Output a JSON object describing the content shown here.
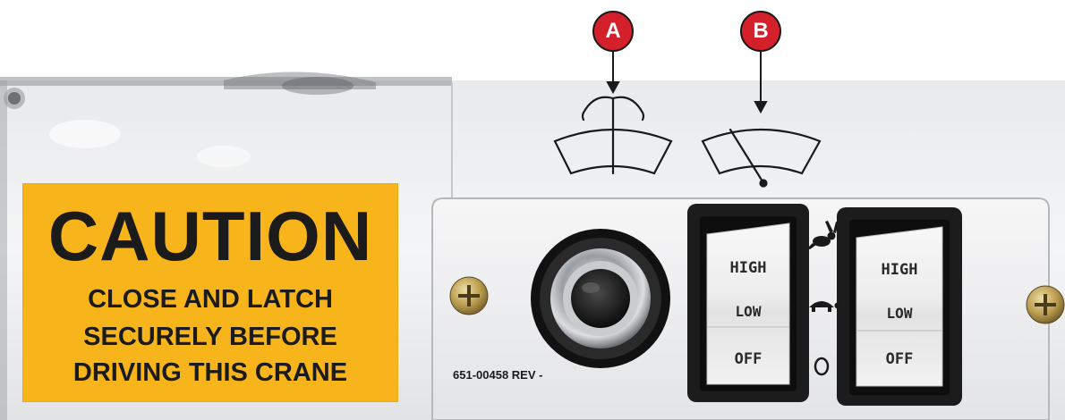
{
  "callouts": {
    "a": "A",
    "b": "B"
  },
  "caution_label": {
    "title": "CAUTION",
    "line1": "CLOSE AND LATCH",
    "line2": "SECURELY BEFORE",
    "line3": "DRIVING THIS CRANE"
  },
  "panel": {
    "part_number": "651-00458 REV -"
  },
  "switches": [
    {
      "high": "HIGH",
      "low": "LOW",
      "off": "OFF"
    },
    {
      "high": "HIGH",
      "low": "LOW",
      "off": "OFF"
    }
  ],
  "icons": {
    "washer": "windshield-washer-icon",
    "wiper": "windshield-wiper-icon",
    "fast": "rabbit-icon",
    "slow": "turtle-icon",
    "off": "circle-off-icon"
  },
  "colors": {
    "callout": "#d4202a",
    "caution_label": "#f7b51b"
  }
}
